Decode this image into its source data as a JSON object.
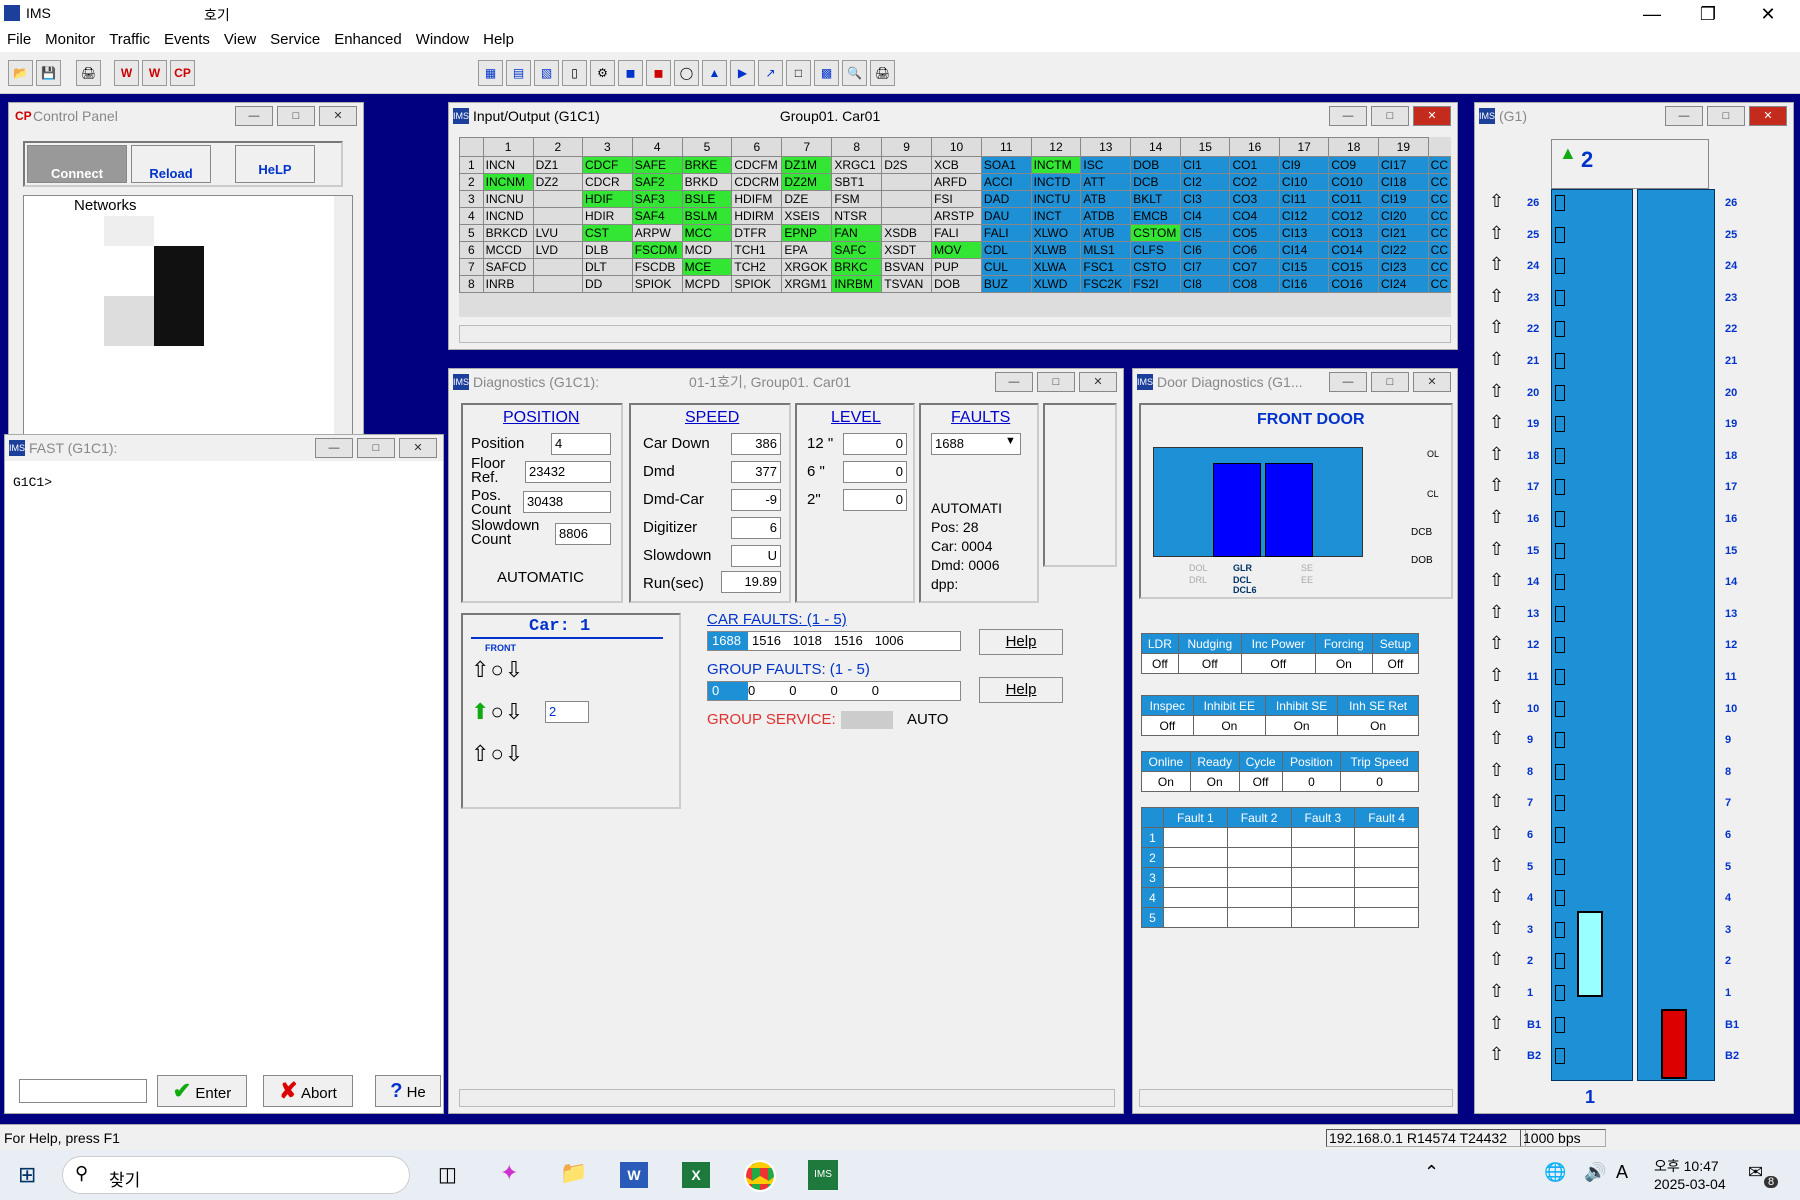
{
  "app": {
    "title": "IMS",
    "subtitle": "호기"
  },
  "menu": [
    "File",
    "Monitor",
    "Traffic",
    "Events",
    "View",
    "Service",
    "Enhanced",
    "Window",
    "Help"
  ],
  "control_panel": {
    "title": "Control Panel",
    "badge": "CP",
    "connect": "Connect",
    "reload": "Reload",
    "help": "HeLP",
    "tree_root": "Networks"
  },
  "io": {
    "title": "Input/Output (G1C1)",
    "title2": "Group01. Car01",
    "cols": [
      "1",
      "2",
      "3",
      "4",
      "5",
      "6",
      "7",
      "8",
      "9",
      "10",
      "11",
      "12",
      "13",
      "14",
      "15",
      "16",
      "17",
      "18",
      "19"
    ],
    "rows": [
      [
        "INCN",
        "DZ1",
        "CDCF",
        "SAFE",
        "BRKE",
        "CDCFM",
        "DZ1M",
        "XRGC1",
        "D2S",
        "XCB",
        "SOA1",
        "INCTM",
        "ISC",
        "DOB",
        "CI1",
        "CO1",
        "CI9",
        "CO9",
        "CI17",
        "CC"
      ],
      [
        "INCNM",
        "DZ2",
        "CDCR",
        "SAF2",
        "BRKD",
        "CDCRM",
        "DZ2M",
        "SBT1",
        "",
        "ARFD",
        "ACCI",
        "INCTD",
        "ATT",
        "DCB",
        "CI2",
        "CO2",
        "CI10",
        "CO10",
        "CI18",
        "CC"
      ],
      [
        "INCNU",
        "",
        "HDIF",
        "SAF3",
        "BSLE",
        "HDIFM",
        "DZE",
        "FSM",
        "",
        "FSI",
        "DAD",
        "INCTU",
        "ATB",
        "BKLT",
        "CI3",
        "CO3",
        "CI11",
        "CO11",
        "CI19",
        "CC"
      ],
      [
        "INCND",
        "",
        "HDIR",
        "SAF4",
        "BSLM",
        "HDIRM",
        "XSEIS",
        "NTSR",
        "",
        "ARSTP",
        "DAU",
        "INCT",
        "ATDB",
        "EMCB",
        "CI4",
        "CO4",
        "CI12",
        "CO12",
        "CI20",
        "CC"
      ],
      [
        "BRKCD",
        "LVU",
        "CST",
        "ARPW",
        "MCC",
        "DTFR",
        "EPNP",
        "FAN",
        "XSDB",
        "FALI",
        "FALI",
        "XLWO",
        "ATUB",
        "CSTOM",
        "CI5",
        "CO5",
        "CI13",
        "CO13",
        "CI21",
        "CC"
      ],
      [
        "MCCD",
        "LVD",
        "DLB",
        "FSCDM",
        "MCD",
        "TCH1",
        "EPA",
        "SAFC",
        "XSDT",
        "MOV",
        "CDL",
        "XLWB",
        "MLS1",
        "CLFS",
        "CI6",
        "CO6",
        "CI14",
        "CO14",
        "CI22",
        "CC"
      ],
      [
        "SAFCD",
        "",
        "DLT",
        "FSCDB",
        "MCE",
        "TCH2",
        "XRGOK",
        "BRKC",
        "BSVAN",
        "PUP",
        "CUL",
        "XLWA",
        "FSC1",
        "CSTO",
        "CI7",
        "CO7",
        "CI15",
        "CO15",
        "CI23",
        "CC"
      ],
      [
        "INRB",
        "",
        "DD",
        "SPIOK",
        "MCPD",
        "SPIOK",
        "XRGM1",
        "INRBM",
        "TSVAN",
        "DOB",
        "BUZ",
        "XLWD",
        "FSC2K",
        "FS2I",
        "CI8",
        "CO8",
        "CI16",
        "CO16",
        "CI24",
        "CC"
      ]
    ],
    "green": [
      "0-2",
      "0-3",
      "0-4",
      "0-6",
      "0-11",
      "1-0",
      "1-3",
      "1-6",
      "2-2",
      "2-3",
      "2-4",
      "3-3",
      "3-4",
      "4-2",
      "4-4",
      "4-6",
      "4-7",
      "4-13",
      "5-3",
      "5-7",
      "5-9",
      "6-4",
      "6-7",
      "7-7"
    ]
  },
  "diag": {
    "title": "Diagnostics (G1C1):",
    "title2": "01-1호기, Group01. Car01",
    "position": {
      "h": "POSITION",
      "items": [
        [
          "Position",
          "4"
        ],
        [
          "Floor Ref.",
          "23432"
        ],
        [
          "Pos. Count",
          "30438"
        ],
        [
          "Slowdown Count",
          "8806"
        ]
      ],
      "mode": "AUTOMATIC"
    },
    "speed": {
      "h": "SPEED",
      "items": [
        [
          "Car Down",
          "386"
        ],
        [
          "Dmd",
          "377"
        ],
        [
          "Dmd-Car",
          "-9"
        ],
        [
          "Digitizer",
          "6"
        ],
        [
          "Slowdown",
          "U"
        ],
        [
          "Run(sec)",
          "19.89"
        ]
      ]
    },
    "level": {
      "h": "LEVEL",
      "items": [
        [
          "12 \"",
          "0"
        ],
        [
          "6 \"",
          "0"
        ],
        [
          "2\"",
          "0"
        ]
      ]
    },
    "faults": {
      "h": "FAULTS",
      "sel": "1688",
      "lines": [
        "AUTOMATI",
        "Pos:  28",
        "Car: 0004",
        "Dmd: 0006",
        "dpp:"
      ]
    },
    "car": {
      "label": "Car: 1",
      "front": "FRONT",
      "floor": "2"
    },
    "car_faults": {
      "label": "CAR FAULTS: (1 - 5)",
      "vals": [
        "1688",
        "1516",
        "1018",
        "1516",
        "1006"
      ]
    },
    "group_faults": {
      "label": "GROUP FAULTS: (1 - 5)",
      "vals": [
        "0",
        "0",
        "0",
        "0",
        "0"
      ]
    },
    "help": "Help",
    "gs_label": "GROUP SERVICE:",
    "gs_val": "AUTO"
  },
  "door": {
    "title": "Door Diagnostics (G1...",
    "front": "FRONT DOOR",
    "labels": {
      "dol": "DOL",
      "drl": "DRL",
      "glr": "GLR",
      "dcl": "DCL",
      "dcl6": "DCL6",
      "se": "SE",
      "ee": "EE",
      "dcb": "DCB",
      "dob": "DOB",
      "ol": "OL",
      "cl": "CL"
    },
    "t1": {
      "h": [
        "LDR",
        "Nudging",
        "Inc Power",
        "Forcing",
        "Setup"
      ],
      "v": [
        "Off",
        "Off",
        "Off",
        "On",
        "Off"
      ]
    },
    "t2": {
      "h": [
        "Inspec",
        "Inhibit EE",
        "Inhibit SE",
        "Inh SE Ret"
      ],
      "v": [
        "Off",
        "On",
        "On",
        "On"
      ]
    },
    "t3": {
      "h": [
        "Online",
        "Ready",
        "Cycle",
        "Position",
        "Trip Speed"
      ],
      "v": [
        "On",
        "On",
        "Off",
        "0",
        "0"
      ]
    },
    "t4": {
      "h": [
        "",
        "Fault 1",
        "Fault 2",
        "Fault 3",
        "Fault 4"
      ],
      "rows": [
        "1",
        "2",
        "3",
        "4",
        "5"
      ]
    }
  },
  "group": {
    "title": "(G1)",
    "car_floor": "2",
    "car_label": "1",
    "floors": [
      "26",
      "25",
      "24",
      "23",
      "22",
      "21",
      "20",
      "19",
      "18",
      "17",
      "16",
      "15",
      "14",
      "13",
      "12",
      "11",
      "10",
      "9",
      "8",
      "7",
      "6",
      "5",
      "4",
      "3",
      "2",
      "1",
      "B1",
      "B2"
    ]
  },
  "fast": {
    "title": "FAST (G1C1):",
    "prompt": "G1C1>",
    "enter": "Enter",
    "abort": "Abort",
    "help": "He"
  },
  "status": {
    "help": "For Help, press F1",
    "addr": "192.168.0.1 R14574 T24432",
    "bps": "1000 bps"
  },
  "taskbar": {
    "search": "찾기",
    "ampm": "오후 10:47",
    "date": "2025-03-04",
    "notif": "8"
  }
}
